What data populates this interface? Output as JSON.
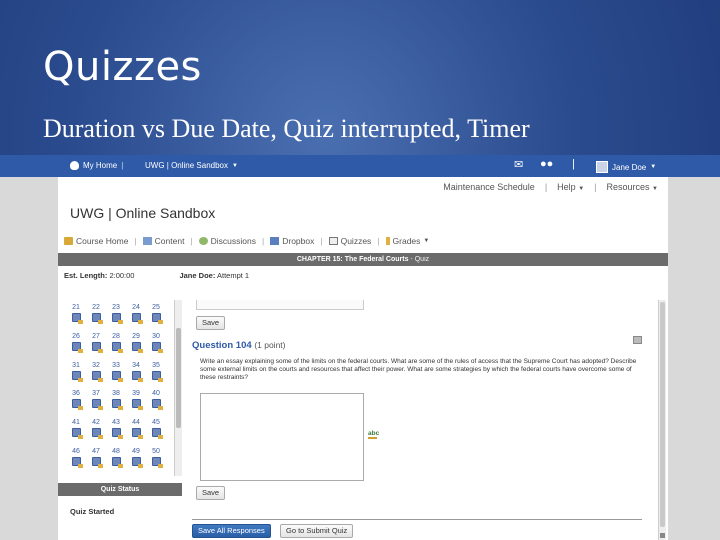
{
  "slide": {
    "title": "Quizzes",
    "subtitle": "Duration vs Due Date, Quiz interrupted, Timer"
  },
  "topbar": {
    "home": "My Home",
    "org": "UWG | Online Sandbox",
    "user": "Jane Doe"
  },
  "util_nav": {
    "maintenance": "Maintenance Schedule",
    "help": "Help",
    "resources": "Resources"
  },
  "org_title": "UWG | Online Sandbox",
  "course_nav": {
    "items": [
      "Course Home",
      "Content",
      "Discussions",
      "Dropbox",
      "Quizzes",
      "Grades"
    ]
  },
  "chapter_bar": {
    "chapter": "CHAPTER 15: The Federal Courts",
    "suffix": "- Quiz"
  },
  "info": {
    "length_label": "Est. Length:",
    "length_value": "2:00:00",
    "attempt_label": "Jane Doe:",
    "attempt_value": "Attempt 1"
  },
  "question_numbers": [
    "21",
    "22",
    "23",
    "24",
    "25",
    "26",
    "27",
    "28",
    "29",
    "30",
    "31",
    "32",
    "33",
    "34",
    "35",
    "36",
    "37",
    "38",
    "39",
    "40",
    "41",
    "42",
    "43",
    "44",
    "45",
    "46",
    "47",
    "48",
    "49",
    "50"
  ],
  "quiz_status": {
    "header": "Quiz Status",
    "state": "Quiz Started"
  },
  "question": {
    "save_top": "Save",
    "heading": "Question 104",
    "points": "(1 point)",
    "text": "Write an essay explaining some of the limits on the federal courts. What are some of the rules of access that the Supreme Court has adopted? Describe some external limits on the courts and resources that affect their power. What are some strategies by which the federal courts have overcome some of these restraints?",
    "save_bottom": "Save",
    "spell_label": "abc"
  },
  "footer_buttons": {
    "save_all": "Save All Responses",
    "submit": "Go to Submit Quiz"
  }
}
